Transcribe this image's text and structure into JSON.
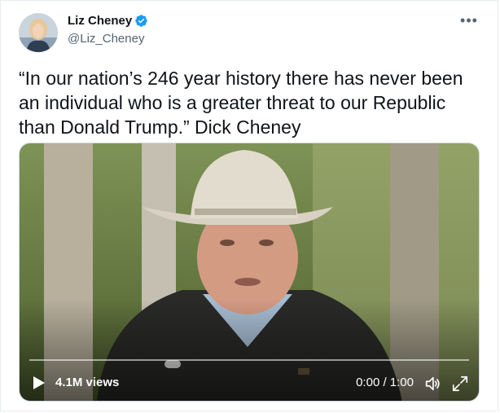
{
  "tweet": {
    "display_name": "Liz Cheney",
    "handle": "@Liz_Cheney",
    "text": "“In our nation’s 246 year history there has never been an individual who is a greater threat to our Republic than Donald Trump.” Dick Cheney",
    "icons": {
      "verified": "verified-badge-icon",
      "more": "more-options-icon"
    },
    "colors": {
      "verified": "#1d9bf0",
      "secondary_text": "#536471"
    }
  },
  "video": {
    "views": "4.1M views",
    "time": "0:00 / 1:00",
    "progress": 0,
    "icons": {
      "play": "play-icon",
      "volume": "volume-icon",
      "fullscreen": "fullscreen-icon"
    }
  }
}
